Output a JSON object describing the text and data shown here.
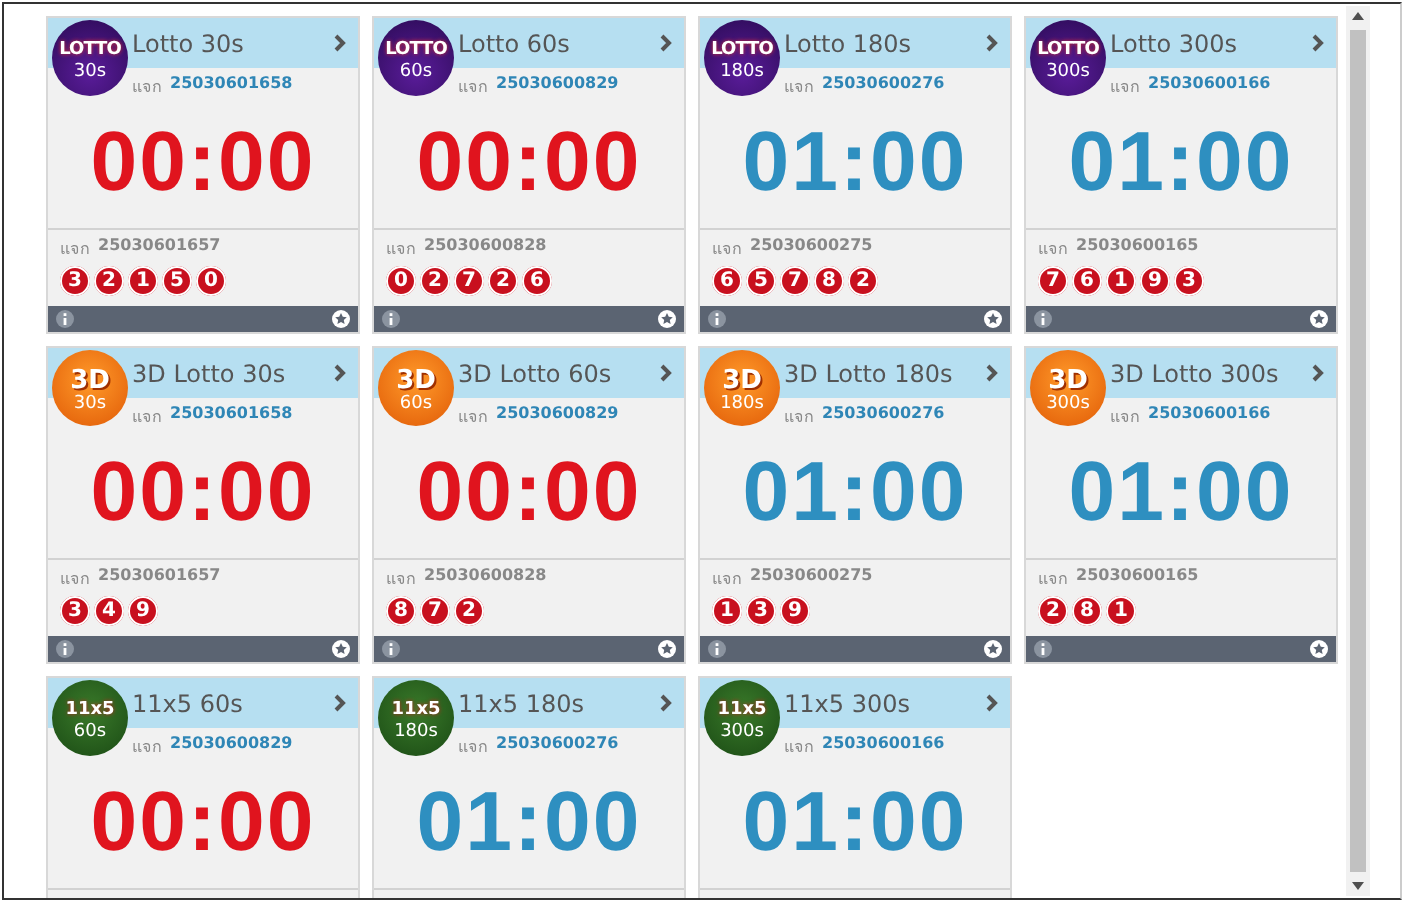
{
  "cards": [
    {
      "title": "Lotto 30s",
      "logo": {
        "kind": "lotto",
        "mark": "LOTTO",
        "duration": "30s"
      },
      "draw_label": "แจก",
      "draw_number": "25030601658",
      "timer": "00:00",
      "color": "#e0141e",
      "last_draw": {
        "label": "แจก",
        "number": "25030601657",
        "balls": [
          "3",
          "2",
          "1",
          "5",
          "0"
        ]
      }
    },
    {
      "title": "Lotto 60s",
      "logo": {
        "kind": "lotto",
        "mark": "LOTTO",
        "duration": "60s"
      },
      "draw_label": "แจก",
      "draw_number": "25030600829",
      "timer": "00:00",
      "color": "#e0141e",
      "last_draw": {
        "label": "แจก",
        "number": "25030600828",
        "balls": [
          "0",
          "2",
          "7",
          "2",
          "6"
        ]
      }
    },
    {
      "title": "Lotto 180s",
      "logo": {
        "kind": "lotto",
        "mark": "LOTTO",
        "duration": "180s"
      },
      "draw_label": "แจก",
      "draw_number": "25030600276",
      "timer": "01:00",
      "color": "#2e8fc0",
      "last_draw": {
        "label": "แจก",
        "number": "25030600275",
        "balls": [
          "6",
          "5",
          "7",
          "8",
          "2"
        ]
      }
    },
    {
      "title": "Lotto 300s",
      "logo": {
        "kind": "lotto",
        "mark": "LOTTO",
        "duration": "300s"
      },
      "draw_label": "แจก",
      "draw_number": "25030600166",
      "timer": "01:00",
      "color": "#2e8fc0",
      "last_draw": {
        "label": "แจก",
        "number": "25030600165",
        "balls": [
          "7",
          "6",
          "1",
          "9",
          "3"
        ]
      }
    },
    {
      "title": "3D Lotto 30s",
      "logo": {
        "kind": "threed",
        "mark": "3D",
        "duration": "30s"
      },
      "draw_label": "แจก",
      "draw_number": "25030601658",
      "timer": "00:00",
      "color": "#e0141e",
      "last_draw": {
        "label": "แจก",
        "number": "25030601657",
        "balls": [
          "3",
          "4",
          "9"
        ]
      }
    },
    {
      "title": "3D Lotto 60s",
      "logo": {
        "kind": "threed",
        "mark": "3D",
        "duration": "60s"
      },
      "draw_label": "แจก",
      "draw_number": "25030600829",
      "timer": "00:00",
      "color": "#e0141e",
      "last_draw": {
        "label": "แจก",
        "number": "25030600828",
        "balls": [
          "8",
          "7",
          "2"
        ]
      }
    },
    {
      "title": "3D Lotto 180s",
      "logo": {
        "kind": "threed",
        "mark": "3D",
        "duration": "180s"
      },
      "draw_label": "แจก",
      "draw_number": "25030600276",
      "timer": "01:00",
      "color": "#2e8fc0",
      "last_draw": {
        "label": "แจก",
        "number": "25030600275",
        "balls": [
          "1",
          "3",
          "9"
        ]
      }
    },
    {
      "title": "3D Lotto 300s",
      "logo": {
        "kind": "threed",
        "mark": "3D",
        "duration": "300s"
      },
      "draw_label": "แจก",
      "draw_number": "25030600166",
      "timer": "01:00",
      "color": "#2e8fc0",
      "last_draw": {
        "label": "แจก",
        "number": "25030600165",
        "balls": [
          "2",
          "8",
          "1"
        ]
      }
    },
    {
      "title": "11x5 60s",
      "logo": {
        "kind": "elevenfive",
        "mark": "11x5",
        "duration": "60s"
      },
      "draw_label": "แจก",
      "draw_number": "25030600829",
      "timer": "00:00",
      "color": "#e0141e"
    },
    {
      "title": "11x5 180s",
      "logo": {
        "kind": "elevenfive",
        "mark": "11x5",
        "duration": "180s"
      },
      "draw_label": "แจก",
      "draw_number": "25030600276",
      "timer": "01:00",
      "color": "#2e8fc0"
    },
    {
      "title": "11x5 300s",
      "logo": {
        "kind": "elevenfive",
        "mark": "11x5",
        "duration": "300s"
      },
      "draw_label": "แจก",
      "draw_number": "25030600166",
      "timer": "01:00",
      "color": "#2e8fc0"
    }
  ]
}
